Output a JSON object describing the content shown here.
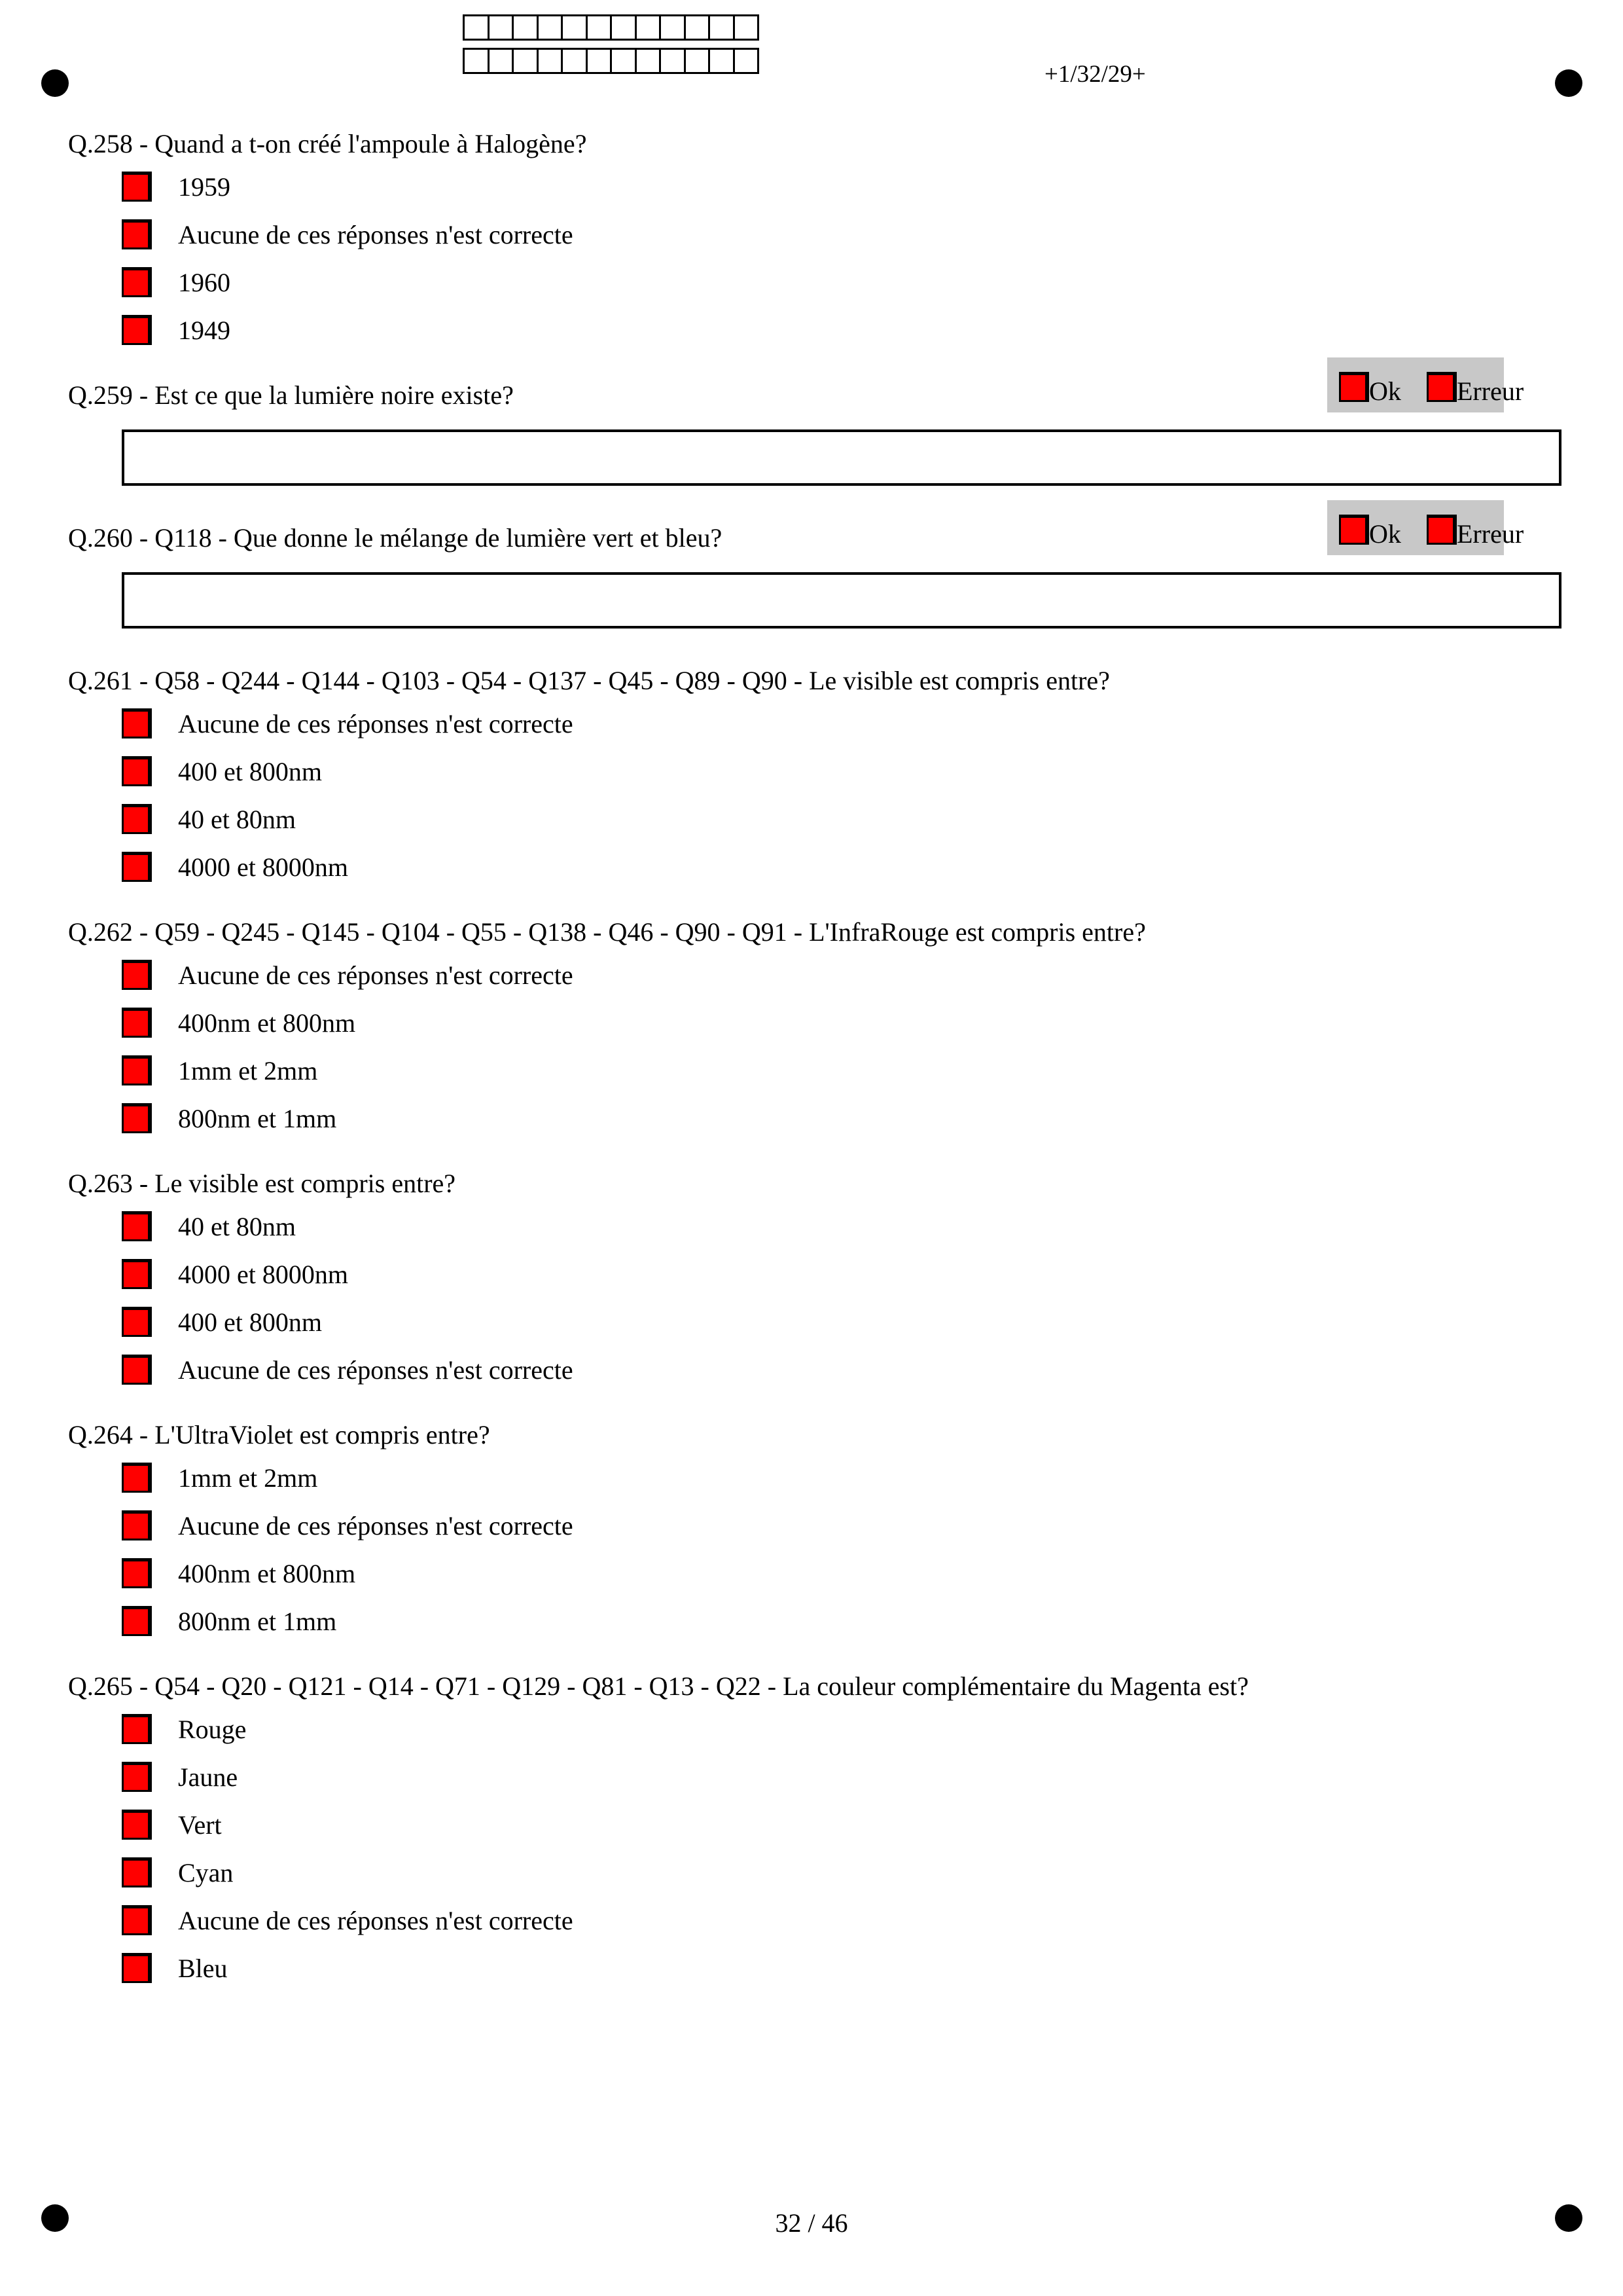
{
  "header": {
    "page_code": "+1/32/29+",
    "id_cells_per_row": 12
  },
  "footer": {
    "page_number": "32 / 46"
  },
  "colors": {
    "checkbox_fill": "#ff0000",
    "ok_panel": "#c8c8c8"
  },
  "questions": [
    {
      "label": "Q.258 - Quand a t-on créé l'ampoule à Halogène?",
      "answers": [
        "1959",
        "Aucune de ces réponses n'est correcte",
        "1960",
        "1949"
      ]
    },
    {
      "label": "Q.259 - Est ce que la lumière noire existe?",
      "ok": "Ok",
      "error": "Erreur"
    },
    {
      "label": "Q.260 - Q118 - Que donne le mélange de lumière vert et bleu?",
      "ok": "Ok",
      "error": "Erreur"
    },
    {
      "label": "Q.261 - Q58 - Q244 - Q144 - Q103 - Q54 - Q137 - Q45 - Q89 - Q90 - Le visible est compris entre?",
      "answers": [
        "Aucune de ces réponses n'est correcte",
        "400 et 800nm",
        "40 et 80nm",
        "4000 et 8000nm"
      ]
    },
    {
      "label": "Q.262 - Q59 - Q245 - Q145 - Q104 - Q55 - Q138 - Q46 - Q90 - Q91 - L'InfraRouge est compris entre?",
      "answers": [
        "Aucune de ces réponses n'est correcte",
        "400nm et 800nm",
        "1mm et 2mm",
        "800nm et 1mm"
      ]
    },
    {
      "label": "Q.263 - Le visible est compris entre?",
      "answers": [
        "40 et 80nm",
        "4000 et 8000nm",
        "400 et 800nm",
        "Aucune de ces réponses n'est correcte"
      ]
    },
    {
      "label": "Q.264 - L'UltraViolet est compris entre?",
      "answers": [
        "1mm et 2mm",
        "Aucune de ces réponses n'est correcte",
        "400nm et 800nm",
        "800nm et 1mm"
      ]
    },
    {
      "label": "Q.265 - Q54 - Q20 - Q121 - Q14 - Q71 - Q129 - Q81 - Q13 - Q22 - La couleur complémentaire du Magenta est?",
      "answers": [
        "Rouge",
        "Jaune",
        "Vert",
        "Cyan",
        "Aucune de ces réponses n'est correcte",
        "Bleu"
      ]
    }
  ]
}
